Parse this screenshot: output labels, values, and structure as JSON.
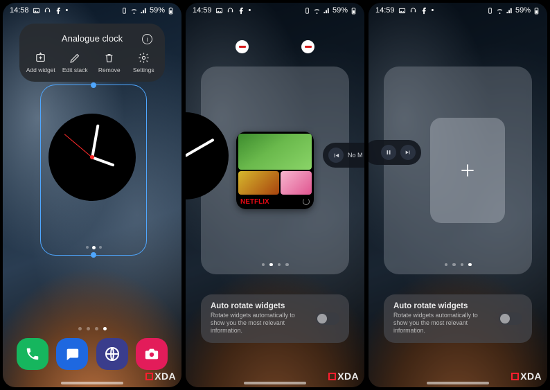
{
  "status": {
    "time_s1": "14:58",
    "time_s2": "14:59",
    "time_s3": "14:59",
    "battery": "59%",
    "indicator_icons": [
      "image-icon",
      "headset-icon",
      "facebook-icon",
      "more-icon"
    ],
    "right_icons": [
      "vibrate-icon",
      "wifi-icon",
      "signal-icon"
    ]
  },
  "s1": {
    "popup": {
      "title": "Analogue clock",
      "actions": [
        {
          "label": "Add widget",
          "name": "add-widget-action"
        },
        {
          "label": "Edit stack",
          "name": "edit-stack-action"
        },
        {
          "label": "Remove",
          "name": "remove-action"
        },
        {
          "label": "Settings",
          "name": "settings-action"
        }
      ]
    },
    "dock": [
      {
        "name": "phone-app",
        "cls": "phone"
      },
      {
        "name": "messages-app",
        "cls": "msg"
      },
      {
        "name": "internet-app",
        "cls": "net"
      },
      {
        "name": "camera-app",
        "cls": "cam"
      }
    ]
  },
  "s2": {
    "netflix_label": "NETFLIX",
    "music_text": "No M"
  },
  "auto_rotate": {
    "title": "Auto rotate widgets",
    "desc": "Rotate widgets automatically to show you the most relevant information."
  },
  "watermark": "XDA"
}
